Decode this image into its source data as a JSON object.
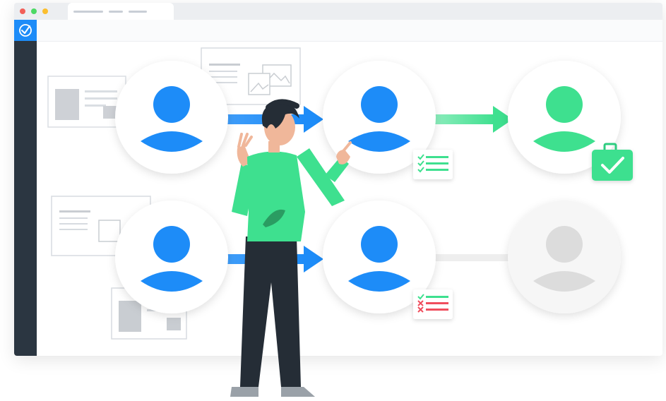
{
  "colors": {
    "accent_blue": "#1d8cf8",
    "accent_green": "#3ee08f",
    "sidebar": "#2b3641",
    "inactive_gray": "#d9d9d9",
    "reject_red": "#f04e5e"
  },
  "icons": {
    "app_logo": "check-badge-icon",
    "candidate": "user-avatar-icon",
    "checklist": "checklist-icon",
    "hired": "briefcase-check-icon"
  }
}
